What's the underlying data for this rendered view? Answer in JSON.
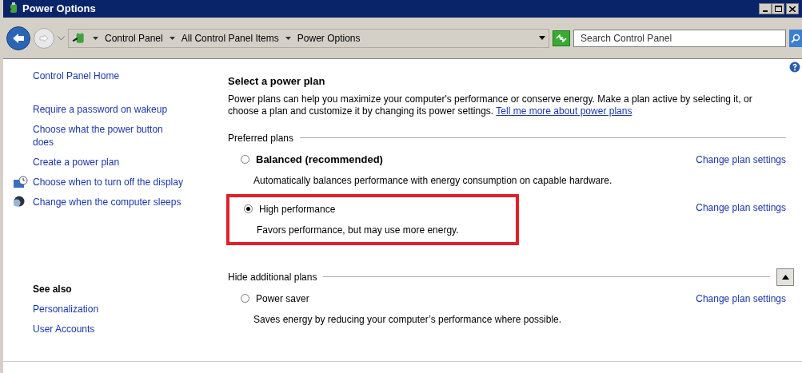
{
  "window": {
    "title": "Power Options"
  },
  "address_bar": {
    "breadcrumbs": [
      "Control Panel",
      "All Control Panel Items",
      "Power Options"
    ]
  },
  "search": {
    "placeholder": "Search Control Panel"
  },
  "sidebar": {
    "items": [
      {
        "label": "Control Panel Home",
        "kind": "plain"
      },
      {
        "label": "Require a password on wakeup",
        "kind": "plain"
      },
      {
        "label": "Choose what the power button does",
        "kind": "plain"
      },
      {
        "label": "Create a power plan",
        "kind": "plain"
      },
      {
        "label": "Choose when to turn off the display",
        "kind": "display"
      },
      {
        "label": "Change when the computer sleeps",
        "kind": "sleep"
      }
    ],
    "see_also": {
      "title": "See also",
      "items": [
        "Personalization",
        "User Accounts"
      ]
    }
  },
  "main": {
    "title": "Select a power plan",
    "intro": "Power plans can help you maximize your computer's performance or conserve energy. Make a plan active by selecting it, or choose a plan and customize it by changing its power settings.",
    "intro_link": "Tell me more about power plans",
    "groups": [
      {
        "title": "Preferred plans",
        "toggle": false,
        "plans": [
          {
            "name": "Balanced (recommended)",
            "bold": true,
            "selected": false,
            "highlighted": false,
            "description": "Automatically balances performance with energy consumption on capable hardware.",
            "link": "Change plan settings"
          },
          {
            "name": "High performance",
            "bold": false,
            "selected": true,
            "highlighted": true,
            "description": "Favors performance, but may use more energy.",
            "link": "Change plan settings"
          }
        ]
      },
      {
        "title": "Hide additional plans",
        "toggle": true,
        "plans": [
          {
            "name": "Power saver",
            "bold": false,
            "selected": false,
            "highlighted": false,
            "description": "Saves energy by reducing your computer’s performance where possible.",
            "link": "Change plan settings"
          }
        ]
      }
    ]
  }
}
